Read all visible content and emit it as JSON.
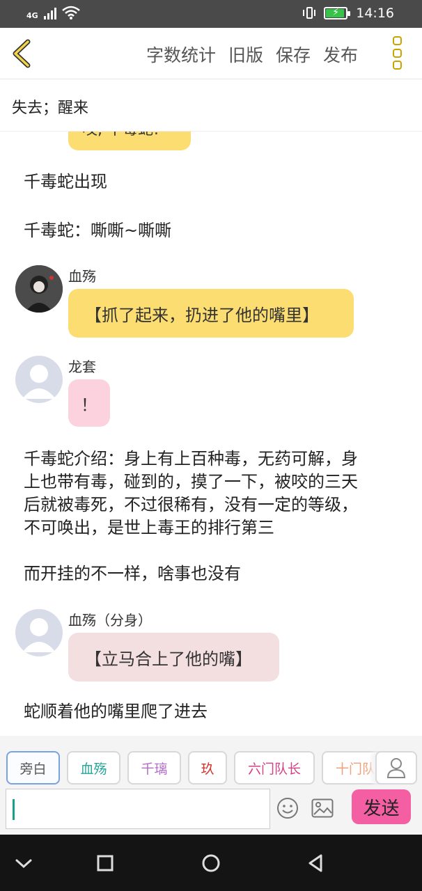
{
  "status_bar": {
    "network": "4G",
    "time": "14:16",
    "battery_color": "#37c24a"
  },
  "toolbar": {
    "word_count": "字数统计",
    "old_version": "旧版",
    "save": "保存",
    "publish": "发布",
    "accent_color": "#c9a400"
  },
  "chapter_title": "失去；醒来",
  "chat": {
    "partial_bubble_text": "哎, 千毒蛇!",
    "messages": [
      {
        "type": "narration",
        "text": "千毒蛇出现"
      },
      {
        "type": "narration",
        "text": "千毒蛇：嘶嘶~嘶嘶"
      },
      {
        "type": "dialog",
        "name": "血殇",
        "text": "【抓了起来，扔进了他的嘴里】",
        "bubble_color": "#fbdd72"
      },
      {
        "type": "dialog",
        "name": "龙套",
        "text": "！",
        "bubble_color": "#fdd2df"
      },
      {
        "type": "narration",
        "lines": [
          "千毒蛇介绍：身上有上百种毒，无药可解，身",
          "上也带有毒，碰到的，摸了一下，被咬的三天",
          "后就被毒死，不过很稀有，没有一定的等级，",
          "不可唤出，是世上毒王的排行第三"
        ]
      },
      {
        "type": "narration",
        "text": "而开挂的不一样，啥事也没有"
      },
      {
        "type": "dialog",
        "name": "血殇（分身）",
        "text": "【立马合上了他的嘴】",
        "bubble_color": "#f4dfe0"
      },
      {
        "type": "narration",
        "text": "蛇顺着他的嘴里爬了进去"
      }
    ]
  },
  "roles": [
    {
      "label": "旁白",
      "color": "#555555"
    },
    {
      "label": "血殇",
      "color": "#22a59a"
    },
    {
      "label": "千璃",
      "color": "#b36cc9"
    },
    {
      "label": "玖",
      "color": "#d0352f"
    },
    {
      "label": "六门队长",
      "color": "#d63f86"
    },
    {
      "label": "十门队",
      "color": "#f0a078"
    }
  ],
  "input": {
    "value": ""
  },
  "send_label": "发送",
  "send_color": "#f35fa2"
}
